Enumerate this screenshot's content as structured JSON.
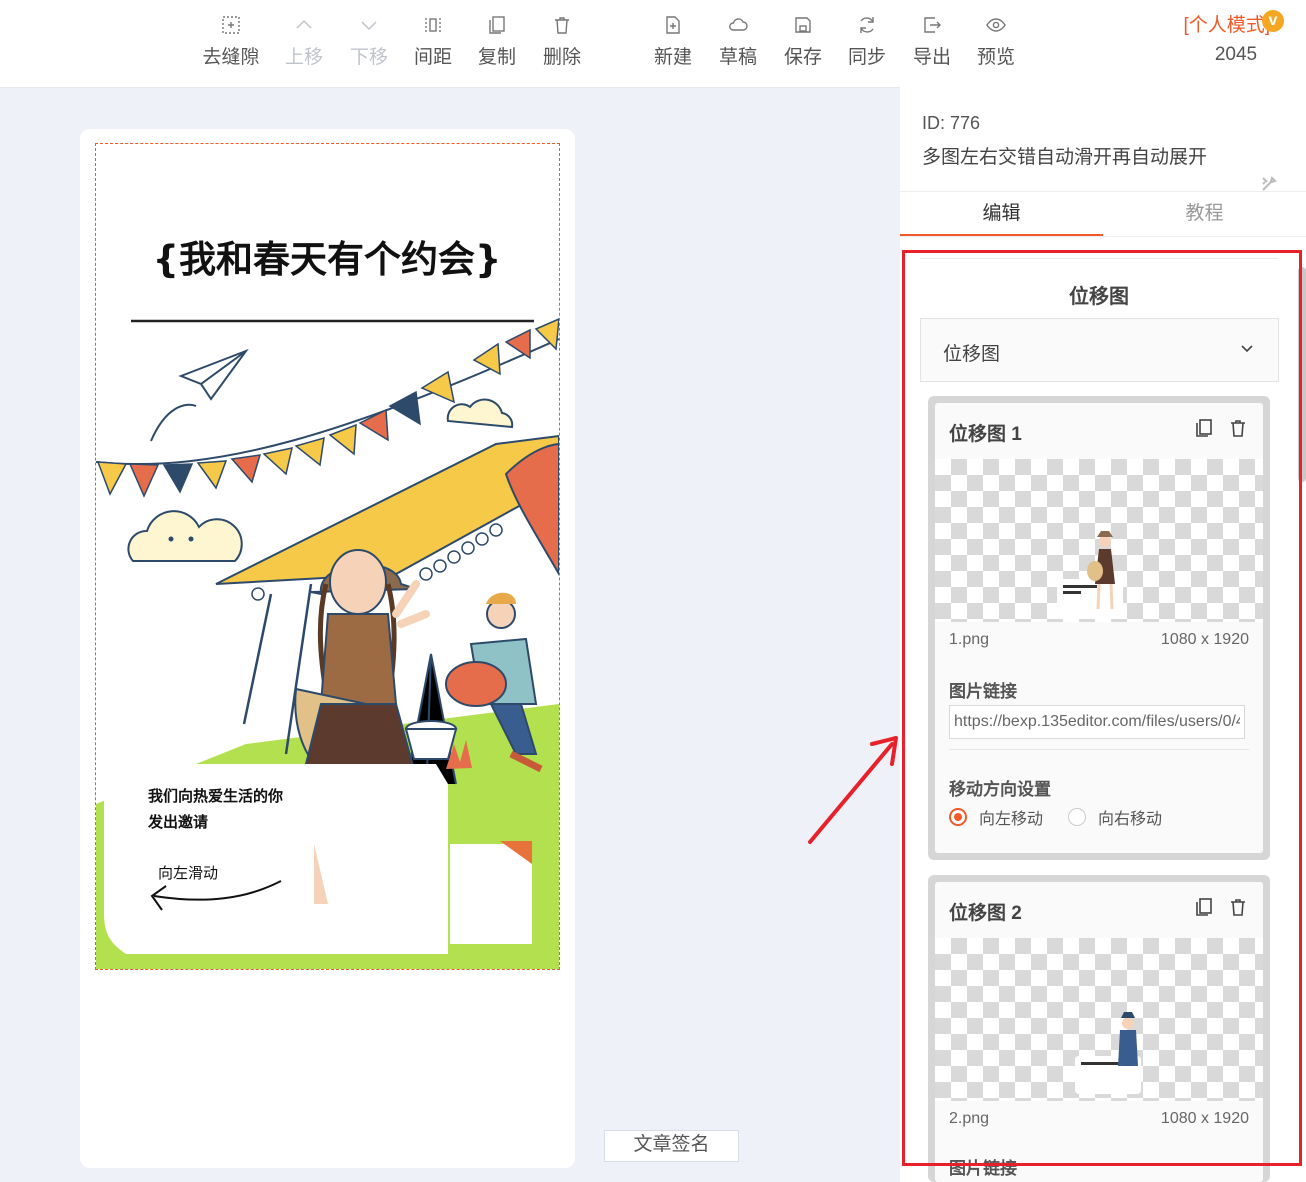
{
  "toolbar": {
    "items": [
      {
        "label": "去缝隙",
        "icon": "remove-gap-icon"
      },
      {
        "label": "上移",
        "icon": "chevron-up-icon"
      },
      {
        "label": "下移",
        "icon": "chevron-down-icon"
      },
      {
        "label": "间距",
        "icon": "spacing-icon"
      },
      {
        "label": "复制",
        "icon": "copy-icon"
      },
      {
        "label": "删除",
        "icon": "trash-icon"
      },
      {
        "label": "新建",
        "icon": "new-file-icon"
      },
      {
        "label": "草稿",
        "icon": "cloud-icon"
      },
      {
        "label": "保存",
        "icon": "save-icon"
      },
      {
        "label": "同步",
        "icon": "sync-icon"
      },
      {
        "label": "导出",
        "icon": "export-icon"
      },
      {
        "label": "预览",
        "icon": "eye-icon"
      }
    ],
    "mode_label": "[个人模式]",
    "vip_badge": "v",
    "count": "2045"
  },
  "canvas": {
    "title": "{我和春天有个约会}",
    "invite_line1": "我们向热爱生活的你",
    "invite_line2": "发出邀请",
    "swipe_hint": "向左滑动",
    "signature_button": "文章签名"
  },
  "panel": {
    "id_label": "ID: 776",
    "template_name": "多图左右交错自动滑开再自动展开",
    "tabs": [
      "编辑",
      "教程"
    ],
    "section_title": "位移图",
    "dropdown_value": "位移图",
    "cards": [
      {
        "title": "位移图 1",
        "file_name": "1.png",
        "file_size": "1080 x 1920",
        "link_label": "图片链接",
        "link_value": "https://bexp.135editor.com/files/users/0/4",
        "direction_label": "移动方向设置",
        "options": [
          "向左移动",
          "向右移动"
        ],
        "selected": "向左移动"
      },
      {
        "title": "位移图 2",
        "file_name": "2.png",
        "file_size": "1080 x 1920",
        "link_label": "图片链接"
      }
    ]
  },
  "colors": {
    "accent": "#f05a28",
    "highlight_red": "#e8202a",
    "lime": "#b3e04e",
    "yellow": "#f7c948",
    "navy": "#2e4a6b"
  }
}
